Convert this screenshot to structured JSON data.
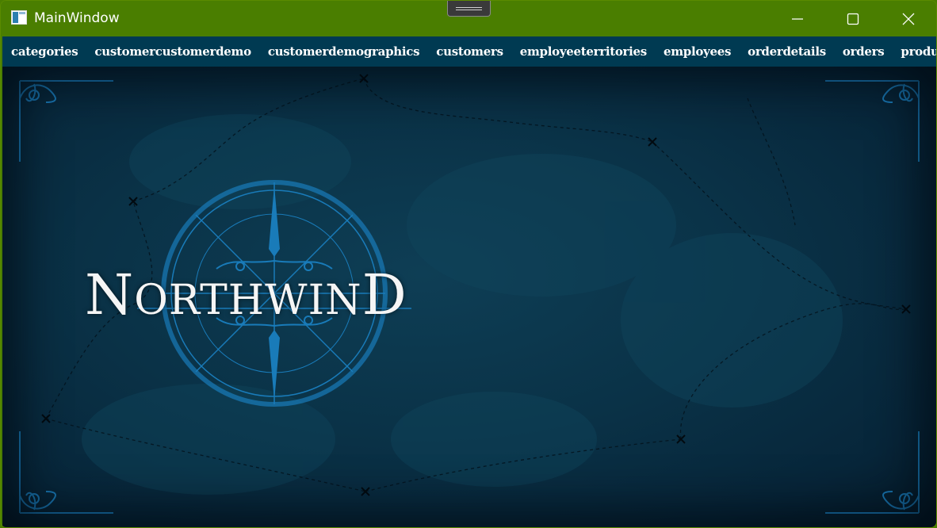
{
  "window": {
    "title": "MainWindow",
    "title_bar_color": "#4a7e00"
  },
  "menu": {
    "background": "#003a52",
    "items": [
      "categories",
      "customercustomerdemo",
      "customerdemographics",
      "customers",
      "employeeterritories",
      "employees",
      "orderdetails",
      "orders",
      "products"
    ]
  },
  "content": {
    "logo_text": "Northwind",
    "accent": "#1a7fbf",
    "background": "#0a3247"
  }
}
